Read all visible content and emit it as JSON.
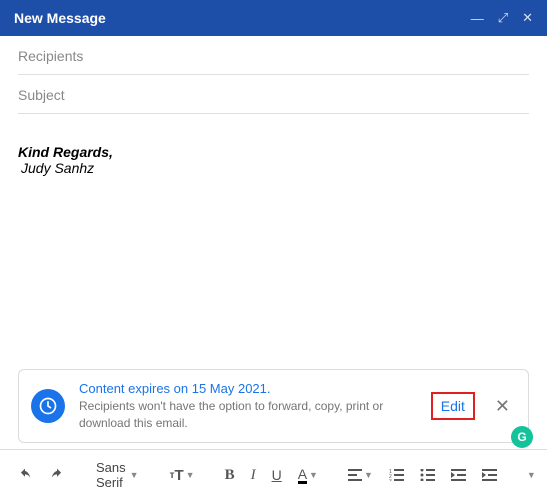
{
  "header": {
    "title": "New Message"
  },
  "fields": {
    "recipients_placeholder": "Recipients",
    "subject_placeholder": "Subject"
  },
  "body": {
    "signature_line1": "Kind Regards,",
    "signature_line2": "Judy Sanhz"
  },
  "confidential": {
    "title": "Content expires on 15 May 2021.",
    "subtitle": "Recipients won't have the option to forward, copy, print or download this email.",
    "edit_label": "Edit"
  },
  "toolbar": {
    "font_family": "Sans Serif"
  }
}
